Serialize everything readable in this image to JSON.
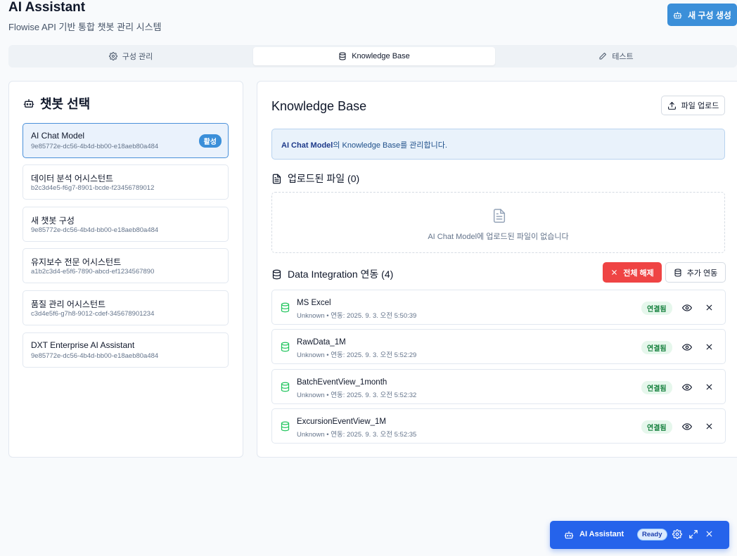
{
  "header": {
    "title": "AI Assistant",
    "subtitle": "Flowise API 기반 통합 챗봇 관리 시스템",
    "new_config_label": "새 구성 생성"
  },
  "tabs": [
    {
      "label": "구성 관리",
      "icon": "gear-icon",
      "active": false
    },
    {
      "label": "Knowledge Base",
      "icon": "database-icon",
      "active": true
    },
    {
      "label": "테스트",
      "icon": "pencil-icon",
      "active": false
    }
  ],
  "sidebar": {
    "title": "챗봇 선택",
    "active_badge": "활성",
    "bots": [
      {
        "name": "AI Chat Model",
        "id": "9e85772e-dc56-4b4d-bb00-e18aeb80a484",
        "active": true
      },
      {
        "name": "데이터 분석 어시스턴트",
        "id": "b2c3d4e5-f6g7-8901-bcde-f23456789012",
        "active": false
      },
      {
        "name": "새 챗봇 구성",
        "id": "9e85772e-dc56-4b4d-bb00-e18aeb80a484",
        "active": false
      },
      {
        "name": "유지보수 전문 어시스턴트",
        "id": "a1b2c3d4-e5f6-7890-abcd-ef1234567890",
        "active": false
      },
      {
        "name": "품질 관리 어시스턴트",
        "id": "c3d4e5f6-g7h8-9012-cdef-345678901234",
        "active": false
      },
      {
        "name": "DXT Enterprise AI Assistant",
        "id": "9e85772e-dc56-4b4d-bb00-e18aeb80a484",
        "active": false
      }
    ]
  },
  "main": {
    "title": "Knowledge Base",
    "upload_label": "파일 업로드",
    "info_bot": "AI Chat Model",
    "info_suffix": "의 Knowledge Base를 관리합니다.",
    "uploaded_heading": "업로드된 파일 (0)",
    "empty_text": "AI Chat Model에 업로드된 파일이 없습니다",
    "integration_heading": "Data Integration 연동 (4)",
    "disconnect_all_label": "전체 해제",
    "add_link_label": "추가 연동",
    "integrations": [
      {
        "name": "MS Excel",
        "meta": "Unknown • 연동: 2025. 9. 3. 오전 5:50:39",
        "status": "연결됨"
      },
      {
        "name": "RawData_1M",
        "meta": "Unknown • 연동: 2025. 9. 3. 오전 5:52:29",
        "status": "연결됨"
      },
      {
        "name": "BatchEventView_1month",
        "meta": "Unknown • 연동: 2025. 9. 3. 오전 5:52:32",
        "status": "연결됨"
      },
      {
        "name": "ExcursionEventView_1M",
        "meta": "Unknown • 연동: 2025. 9. 3. 오전 5:52:35",
        "status": "연결됨"
      }
    ]
  },
  "widget": {
    "title": "AI Assistant",
    "status": "Ready"
  },
  "colors": {
    "primary": "#3b8fd9",
    "danger": "#ef4444",
    "success": "#15803d",
    "widget": "#2563eb"
  }
}
